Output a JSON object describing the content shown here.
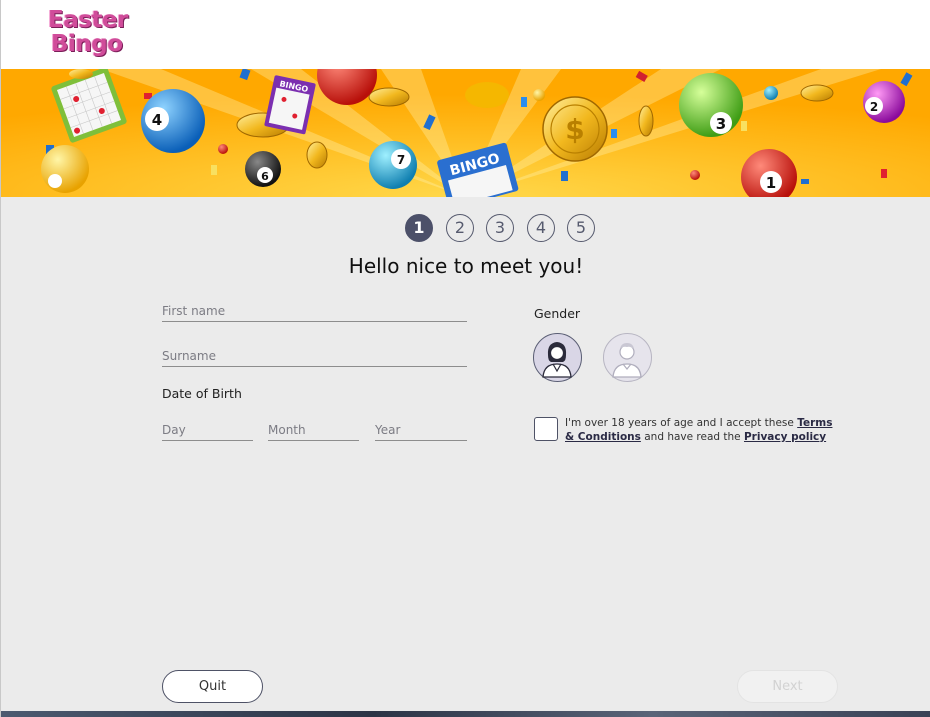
{
  "logo": {
    "line1": "Easter",
    "line2": "Bingo"
  },
  "banner": {
    "ball_numbers": [
      "4",
      "6",
      "7",
      "3",
      "1",
      "2"
    ],
    "card_labels": [
      "BINGO",
      "BINGO"
    ],
    "coin_symbol": "$"
  },
  "stepper": {
    "current": 1,
    "steps": [
      "1",
      "2",
      "3",
      "4",
      "5"
    ]
  },
  "form": {
    "title": "Hello nice to meet you!",
    "first_name_placeholder": "First name",
    "surname_placeholder": "Surname",
    "dob_label": "Date of Birth",
    "day_placeholder": "Day",
    "month_placeholder": "Month",
    "year_placeholder": "Year",
    "gender_label": "Gender",
    "terms_text_1": "I'm over 18 years of age and I accept these ",
    "terms_link": "Terms & Conditions",
    "terms_text_2": " and have read the ",
    "privacy_link": "Privacy policy"
  },
  "buttons": {
    "quit": "Quit",
    "next": "Next"
  },
  "colors": {
    "accent": "#4c5069",
    "logo": "#d04c9a",
    "banner_bg": "#ffb400",
    "page_bg": "#ebebeb"
  }
}
